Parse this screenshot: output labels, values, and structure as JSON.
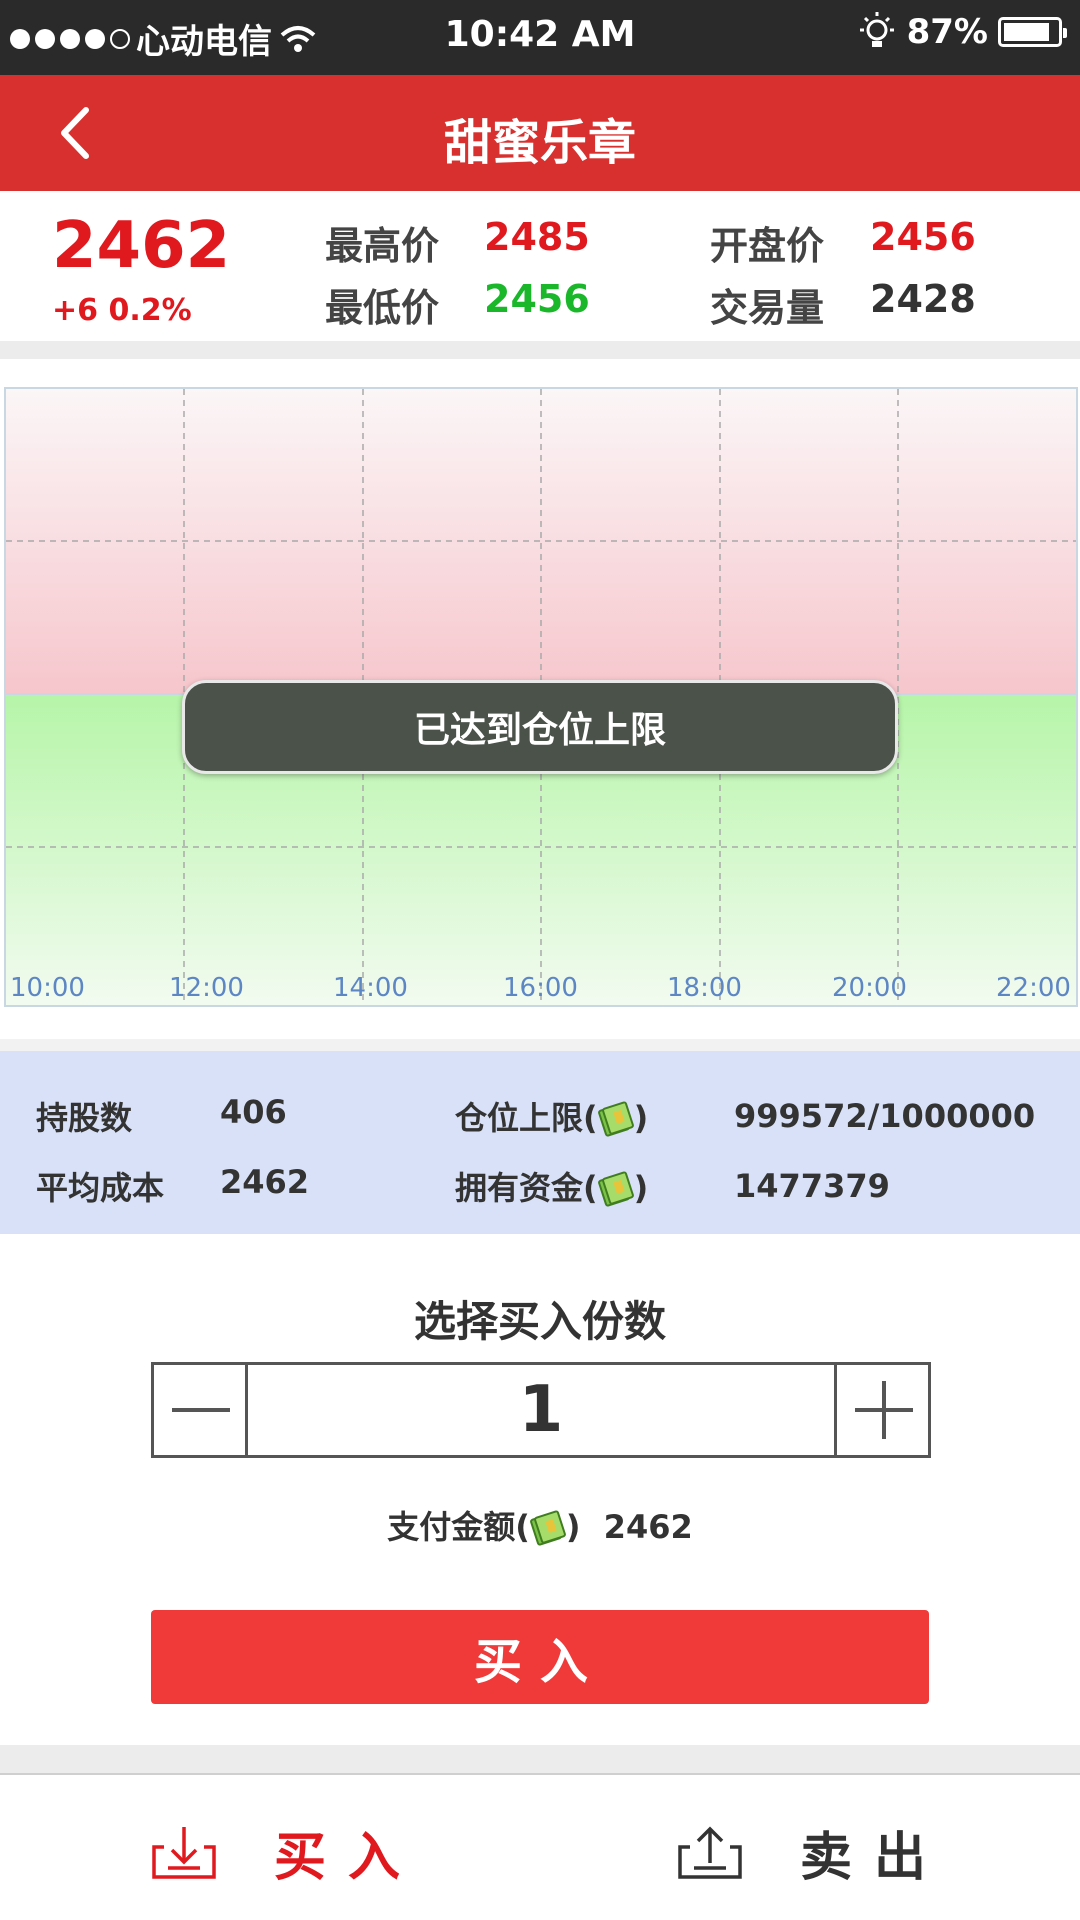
{
  "status_bar": {
    "carrier": "心动电信",
    "time": "10:42 AM",
    "battery": "87%"
  },
  "nav": {
    "title": "甜蜜乐章"
  },
  "quote": {
    "price": "2462",
    "change": "+6 0.2%",
    "high_label": "最高价",
    "high_value": "2485",
    "low_label": "最低价",
    "low_value": "2456",
    "open_label": "开盘价",
    "open_value": "2456",
    "volume_label": "交易量",
    "volume_value": "2428"
  },
  "chart_data": {
    "type": "line",
    "x_ticks": [
      "10:00",
      "12:00",
      "14:00",
      "16:00",
      "18:00",
      "20:00",
      "22:00"
    ],
    "series": [],
    "grid": true,
    "colors": {
      "above": "#f6c6cc",
      "below": "#b6f5a8"
    }
  },
  "toast": {
    "message": "已达到仓位上限"
  },
  "holdings": {
    "shares_label": "持股数",
    "shares_value": "406",
    "avg_cost_label": "平均成本",
    "avg_cost_value": "2462",
    "position_limit_label_pre": "仓位上限(",
    "position_limit_label_post": ")",
    "position_limit_value": "999572/1000000",
    "funds_label_pre": "拥有资金(",
    "funds_label_post": ")",
    "funds_value": "1477379"
  },
  "buy": {
    "title": "选择买入份数",
    "quantity": "1",
    "pay_label_pre": "支付金额(",
    "pay_label_post": ")",
    "pay_amount": "2462",
    "buy_button": "买入"
  },
  "tabs": {
    "buy_label": "买入",
    "sell_label": "卖出",
    "buy_color": "#e0191f",
    "sell_color": "#333333"
  }
}
